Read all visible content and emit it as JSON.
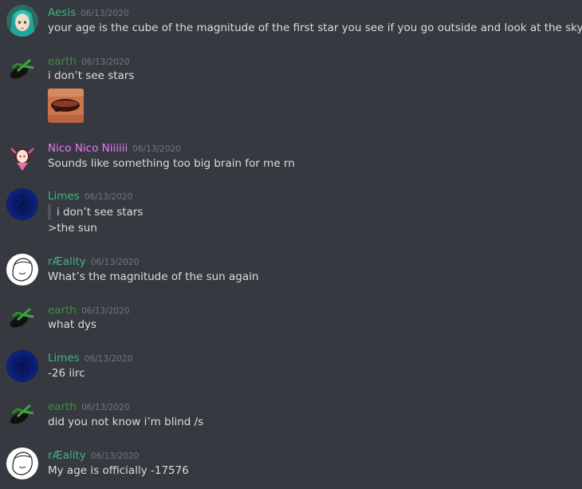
{
  "messages": [
    {
      "username": "Aesis",
      "color": "#43b581",
      "timestamp": "06/13/2020",
      "avatar_icon": "teal-hair-anime-avatar",
      "lines": [
        "your age is the cube of the magnitude of the first star you see if you go outside and look at the sky"
      ]
    },
    {
      "username": "earth",
      "color": "#3e8e41",
      "timestamp": "06/13/2020",
      "avatar_icon": "green-leaf-eye-avatar",
      "lines": [
        "i don’t see stars"
      ],
      "attachment": "lips-closeup-image"
    },
    {
      "username": "Nico Nico Niiiiii",
      "color": "#e879f9",
      "timestamp": "06/13/2020",
      "avatar_icon": "anime-girl-avatar",
      "lines": [
        "Sounds like something too big brain for me rn"
      ]
    },
    {
      "username": "Limes",
      "color": "#43b581",
      "timestamp": "06/13/2020",
      "avatar_icon": "dark-blue-circle-avatar",
      "quote": "i don’t see stars",
      "lines": [
        ">the sun"
      ]
    },
    {
      "username": "rÆality",
      "color": "#43b581",
      "timestamp": "06/13/2020",
      "avatar_icon": "white-sketch-face-avatar",
      "lines": [
        "What’s the magnitude of the sun again"
      ]
    },
    {
      "username": "earth",
      "color": "#3e8e41",
      "timestamp": "06/13/2020",
      "avatar_icon": "green-leaf-eye-avatar",
      "lines": [
        "what dys"
      ]
    },
    {
      "username": "Limes",
      "color": "#43b581",
      "timestamp": "06/13/2020",
      "avatar_icon": "dark-blue-circle-avatar",
      "lines": [
        "-26 iirc"
      ]
    },
    {
      "username": "earth",
      "color": "#3e8e41",
      "timestamp": "06/13/2020",
      "avatar_icon": "green-leaf-eye-avatar",
      "lines": [
        "did you not know i’m blind /s"
      ]
    },
    {
      "username": "rÆality",
      "color": "#43b581",
      "timestamp": "06/13/2020",
      "avatar_icon": "white-sketch-face-avatar",
      "lines": [
        "My age is officially -17576"
      ]
    }
  ]
}
